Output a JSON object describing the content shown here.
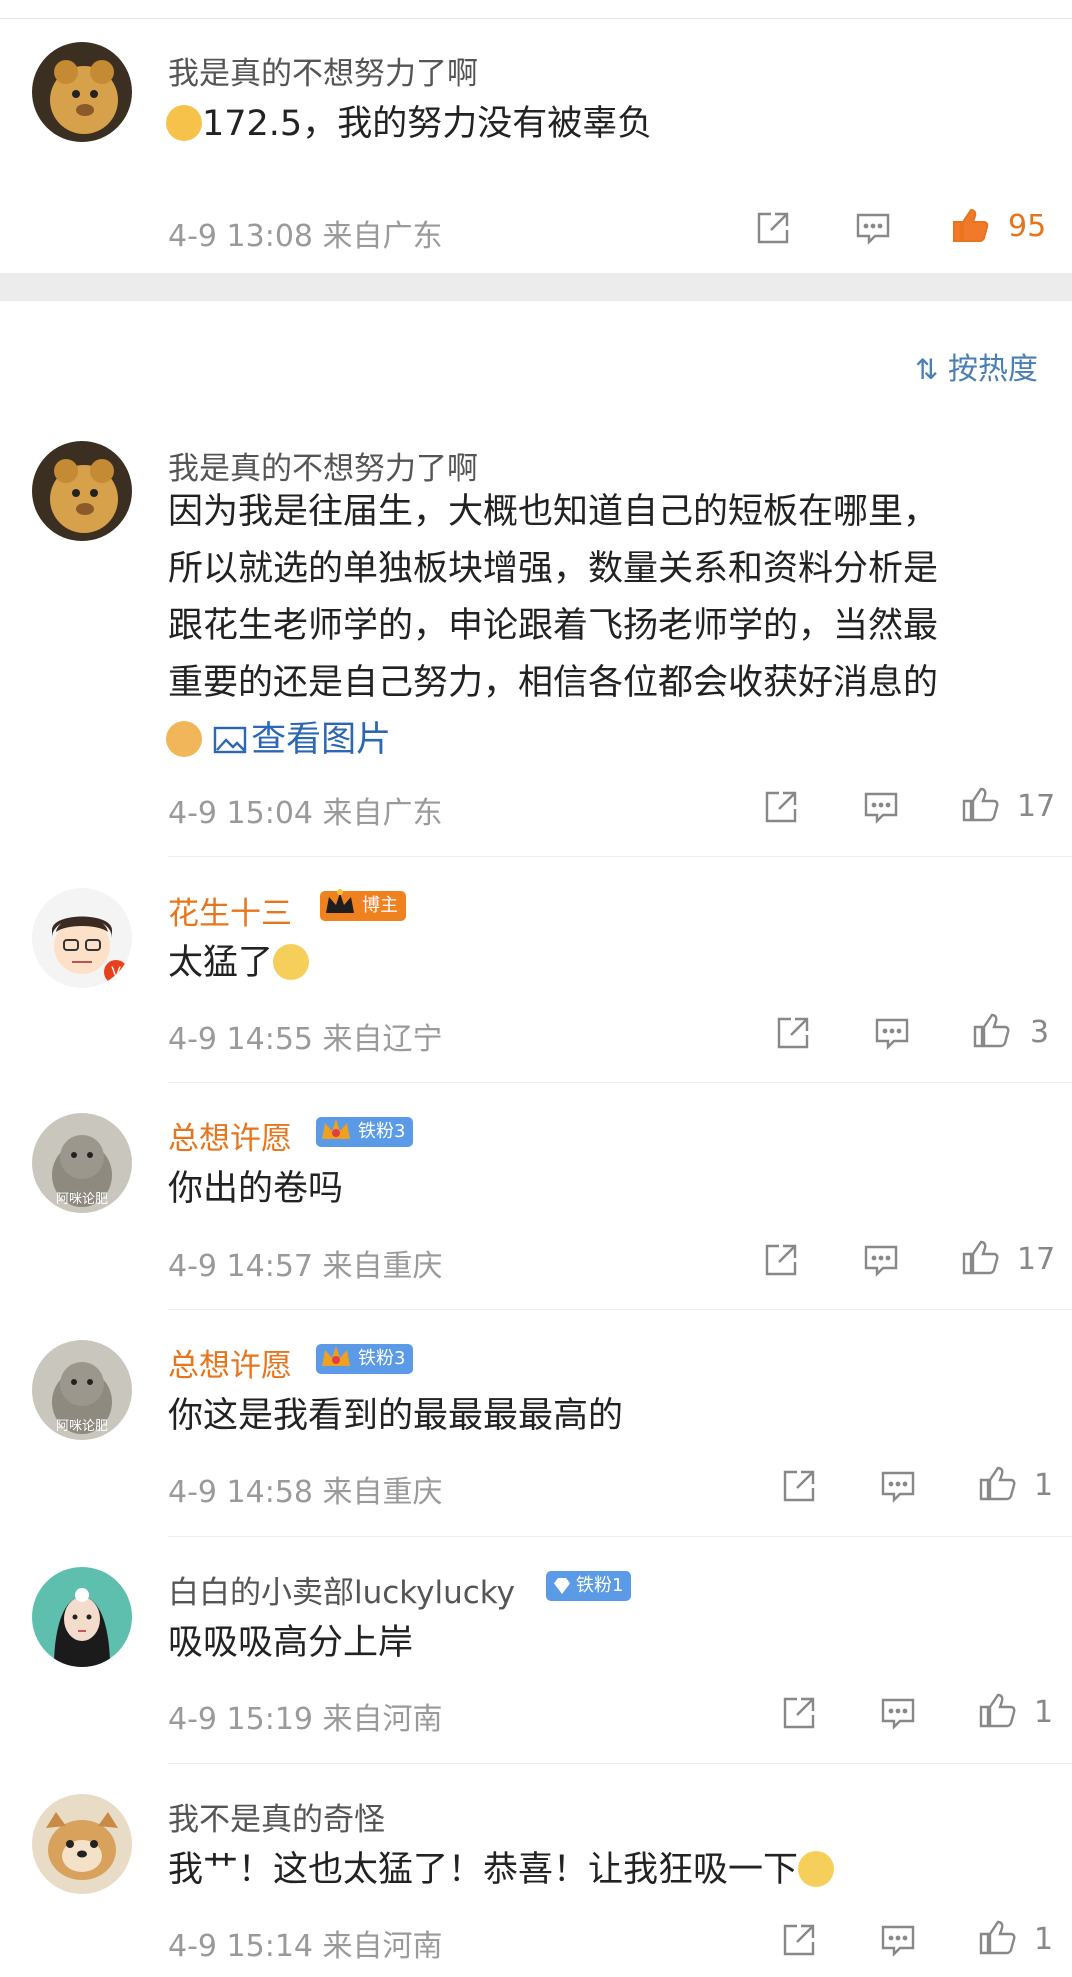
{
  "sort_label": "按热度",
  "colors": {
    "accent_orange": "#e8741c",
    "link_blue": "#2c67b3",
    "meta_gray": "#9a9a9a"
  },
  "top_comment": {
    "user": "我是真的不想努力了啊",
    "emoji": "crying-emoji",
    "text": "172.5，我的努力没有被辜负",
    "time": "4-9 13:08",
    "location": "来自广东",
    "likes": "95"
  },
  "comments": [
    {
      "user": "我是真的不想努力了啊",
      "lines": [
        "因为我是往届生，大概也知道自己的短板在哪里，",
        "所以就选的单独板块增强，数量关系和资料分析是",
        "跟花生老师学的，申论跟着飞扬老师学的，当然最",
        "重要的还是自己努力，相信各位都会收获好消息的"
      ],
      "view_image": "查看图片",
      "time": "4-9 15:04",
      "location": "来自广东",
      "likes": "17"
    },
    {
      "user": "花生十三",
      "badge": "博主",
      "text": "太猛了",
      "time": "4-9 14:55",
      "location": "来自辽宁",
      "likes": "3"
    },
    {
      "user": "总想许愿",
      "badge": "铁粉3",
      "avatar_text": "阿咪论肥",
      "text": "你出的卷吗",
      "time": "4-9 14:57",
      "location": "来自重庆",
      "likes": "17"
    },
    {
      "user": "总想许愿",
      "badge": "铁粉3",
      "avatar_text": "阿咪论肥",
      "text": "你这是我看到的最最最最高的",
      "time": "4-9 14:58",
      "location": "来自重庆",
      "likes": "1"
    },
    {
      "user": "白白的小卖部luckylucky",
      "badge": "铁粉1",
      "text": "吸吸吸高分上岸",
      "time": "4-9 15:19",
      "location": "来自河南",
      "likes": "1"
    },
    {
      "user": "我不是真的奇怪",
      "text": "我艹！这也太猛了！恭喜！让我狂吸一下",
      "time": "4-9 15:14",
      "location": "来自河南",
      "likes": "1"
    }
  ]
}
